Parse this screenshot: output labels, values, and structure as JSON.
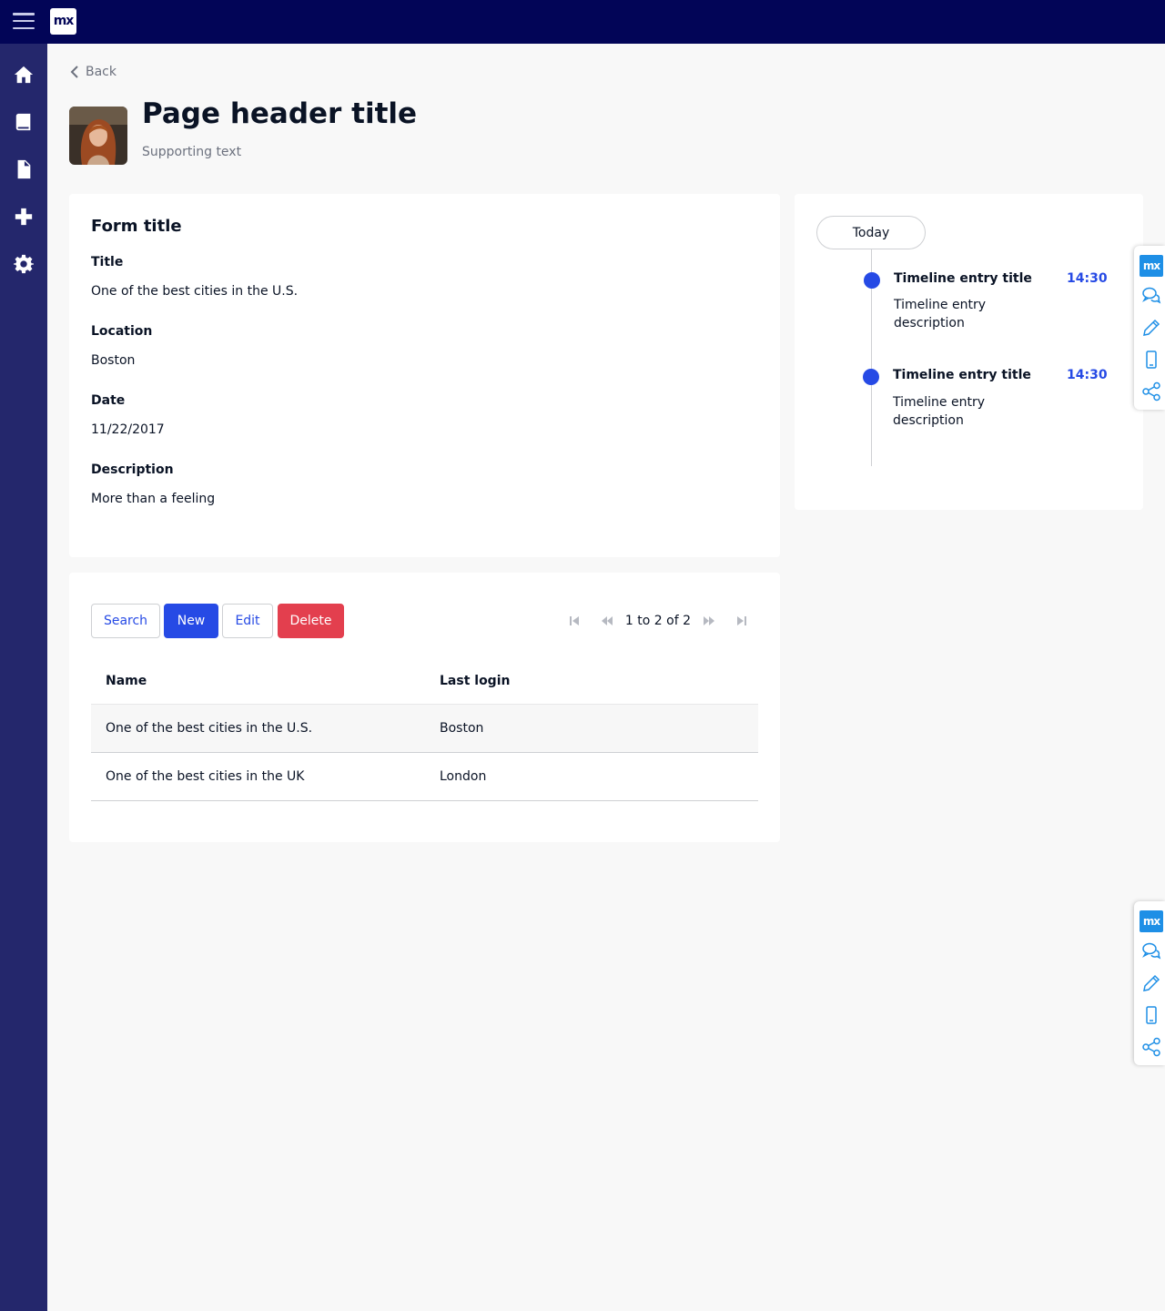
{
  "app": {
    "logo_text": "mx"
  },
  "nav": {
    "back_label": "Back"
  },
  "header": {
    "title": "Page header title",
    "supporting_text": "Supporting text"
  },
  "form": {
    "title": "Form title",
    "fields": [
      {
        "label": "Title",
        "value": "One of the best cities in the U.S."
      },
      {
        "label": "Location",
        "value": "Boston"
      },
      {
        "label": "Date",
        "value": "11/22/2017"
      },
      {
        "label": "Description",
        "value": "More than a feeling"
      }
    ]
  },
  "grid": {
    "buttons": {
      "search": "Search",
      "new": "New",
      "edit": "Edit",
      "delete": "Delete"
    },
    "pager_text": "1 to 2 of 2",
    "columns": [
      "Name",
      "Last login"
    ],
    "rows": [
      [
        "One of the best cities in the U.S.",
        "Boston"
      ],
      [
        "One of the best cities in the UK",
        "London"
      ]
    ]
  },
  "timeline": {
    "header_label": "Today",
    "entries": [
      {
        "title": "Timeline entry title",
        "time": "14:30",
        "description": "Timeline entry description"
      },
      {
        "title": "Timeline entry title",
        "time": "14:30",
        "description": "Timeline entry description"
      }
    ]
  },
  "dock": {
    "logo_text": "mx"
  },
  "colors": {
    "topbar": "#020557",
    "sidebar": "#24276c",
    "primary": "#264ae5",
    "danger": "#e33f4e"
  }
}
